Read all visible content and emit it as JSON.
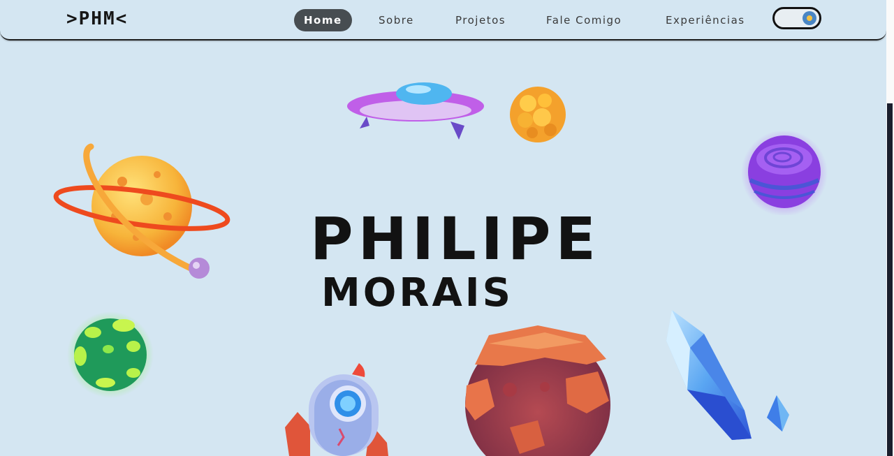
{
  "navbar": {
    "logo": ">PHM<",
    "items": [
      {
        "label": "Home",
        "active": true
      },
      {
        "label": "Sobre",
        "active": false
      },
      {
        "label": "Projetos",
        "active": false
      },
      {
        "label": "Fale Comigo",
        "active": false
      },
      {
        "label": "Experiências",
        "active": false
      }
    ],
    "theme_toggle": {
      "state": "on"
    }
  },
  "hero": {
    "first_name": "PHILIPE",
    "last_name": "MORAIS"
  },
  "illustrations": [
    {
      "name": "ringed-planet",
      "color": "#f7b43a"
    },
    {
      "name": "ufo",
      "color": "#b55ee8"
    },
    {
      "name": "bubbly-planet",
      "color": "#f4a12c"
    },
    {
      "name": "swirl-planet",
      "color": "#8a3fe0"
    },
    {
      "name": "green-planet",
      "color": "#1f9a5a"
    },
    {
      "name": "rocket",
      "color": "#8fa8e8"
    },
    {
      "name": "rock-planet",
      "color": "#c1573a"
    },
    {
      "name": "crystal",
      "color": "#3f7ee8"
    }
  ],
  "colors": {
    "background": "#d4e6f2",
    "active_pill": "#474d51",
    "text": "#121212"
  }
}
